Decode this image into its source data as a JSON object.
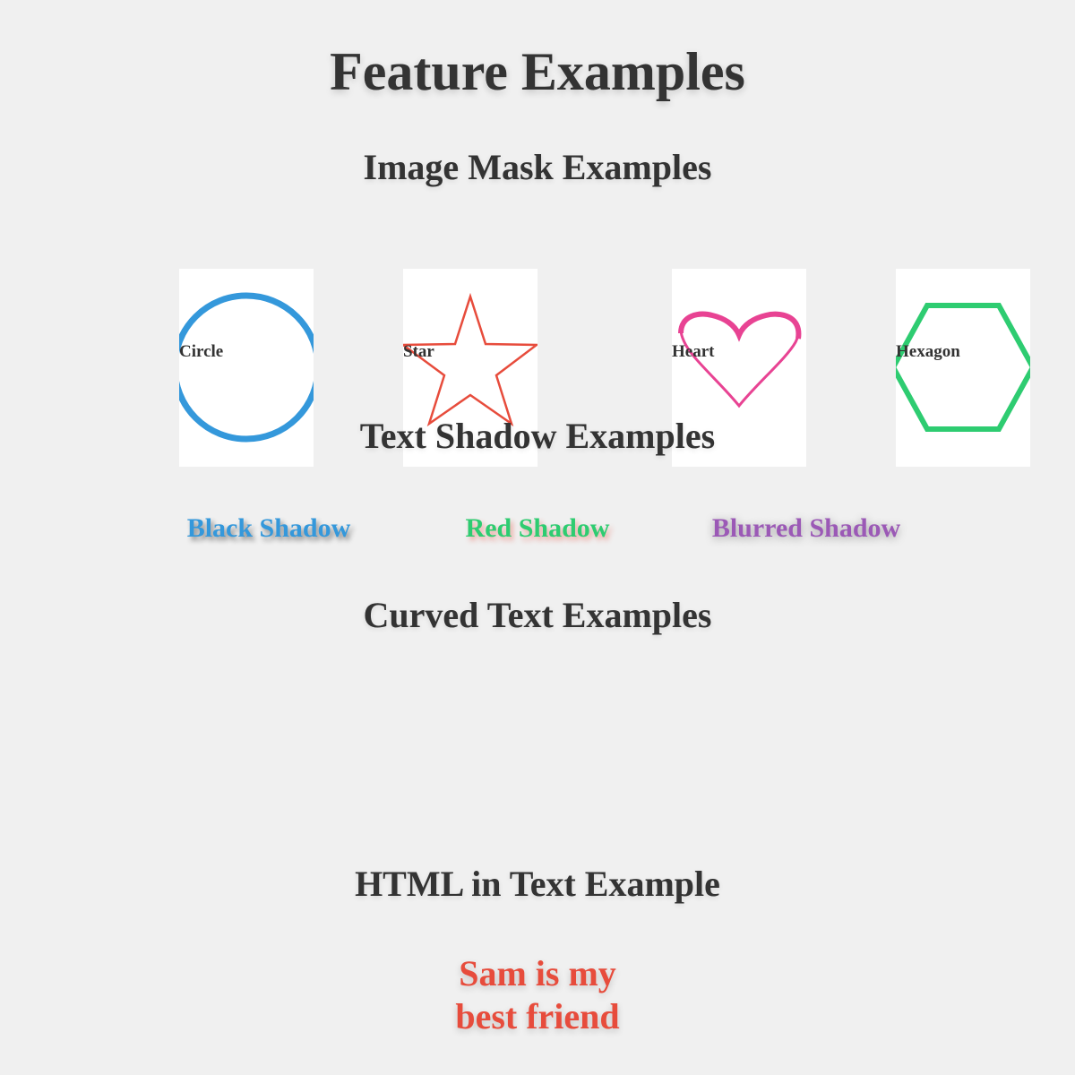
{
  "page": {
    "title": "Feature Examples"
  },
  "sections": {
    "image_mask": {
      "title": "Image Mask Examples",
      "items": [
        {
          "label": "Circle",
          "shape": "circle-icon",
          "color": "#3498db"
        },
        {
          "label": "Star",
          "shape": "star-icon",
          "color": "#e74c3c"
        },
        {
          "label": "Heart",
          "shape": "heart-icon",
          "color": "#e84393"
        },
        {
          "label": "Hexagon",
          "shape": "hexagon-icon",
          "color": "#2ecc71"
        }
      ]
    },
    "text_shadow": {
      "title": "Text Shadow Examples",
      "items": [
        {
          "label": "Black Shadow",
          "color": "#3498db",
          "shadow_color": "#000000"
        },
        {
          "label": "Red Shadow",
          "color": "#2ecc71",
          "shadow_color": "#e74c3c"
        },
        {
          "label": "Blurred Shadow",
          "color": "#9b59b6",
          "shadow_color": "#000000"
        }
      ]
    },
    "curved_text": {
      "title": "Curved Text Examples"
    },
    "html_in_text": {
      "title": "HTML in Text Example",
      "lines": [
        "Sam is my",
        "best friend"
      ],
      "color": "#e74c3c"
    }
  }
}
